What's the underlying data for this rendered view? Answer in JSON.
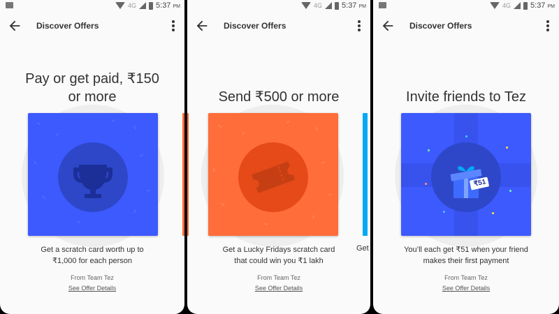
{
  "status_bar": {
    "network": "4G",
    "time": "5:37",
    "ampm": "PM"
  },
  "app_bar": {
    "title": "Discover Offers"
  },
  "offers": [
    {
      "headline_line1": "Pay or get paid, ₹150",
      "headline_line2": "or more",
      "card_color": "#3d5afe",
      "icon": "trophy-icon",
      "desc_line1": "Get a scratch card worth up to",
      "desc_line2": "₹1,000 for each person",
      "from": "From Team Tez",
      "details": "See Offer Details"
    },
    {
      "headline_line1": "Send ₹500 or more",
      "card_color": "#ff6d3a",
      "icon": "ticket-icon",
      "desc_line1": "Get a Lucky Fridays scratch card",
      "desc_line2": "that could win you ₹1 lakh",
      "from": "From Team Tez",
      "details": "See Offer Details"
    },
    {
      "headline_line1": "Invite friends to Tez",
      "card_color": "#3d5afe",
      "icon": "gift-icon",
      "gift_tag": "₹51",
      "desc_line1": "You’ll each get ₹51 when your friend",
      "desc_line2": "makes their first payment",
      "from": "From Team Tez",
      "details": "See Offer Details"
    }
  ],
  "peek_text": "Get",
  "peek_colors": {
    "left": "#ff6d3a",
    "right": "#03a9f4"
  }
}
